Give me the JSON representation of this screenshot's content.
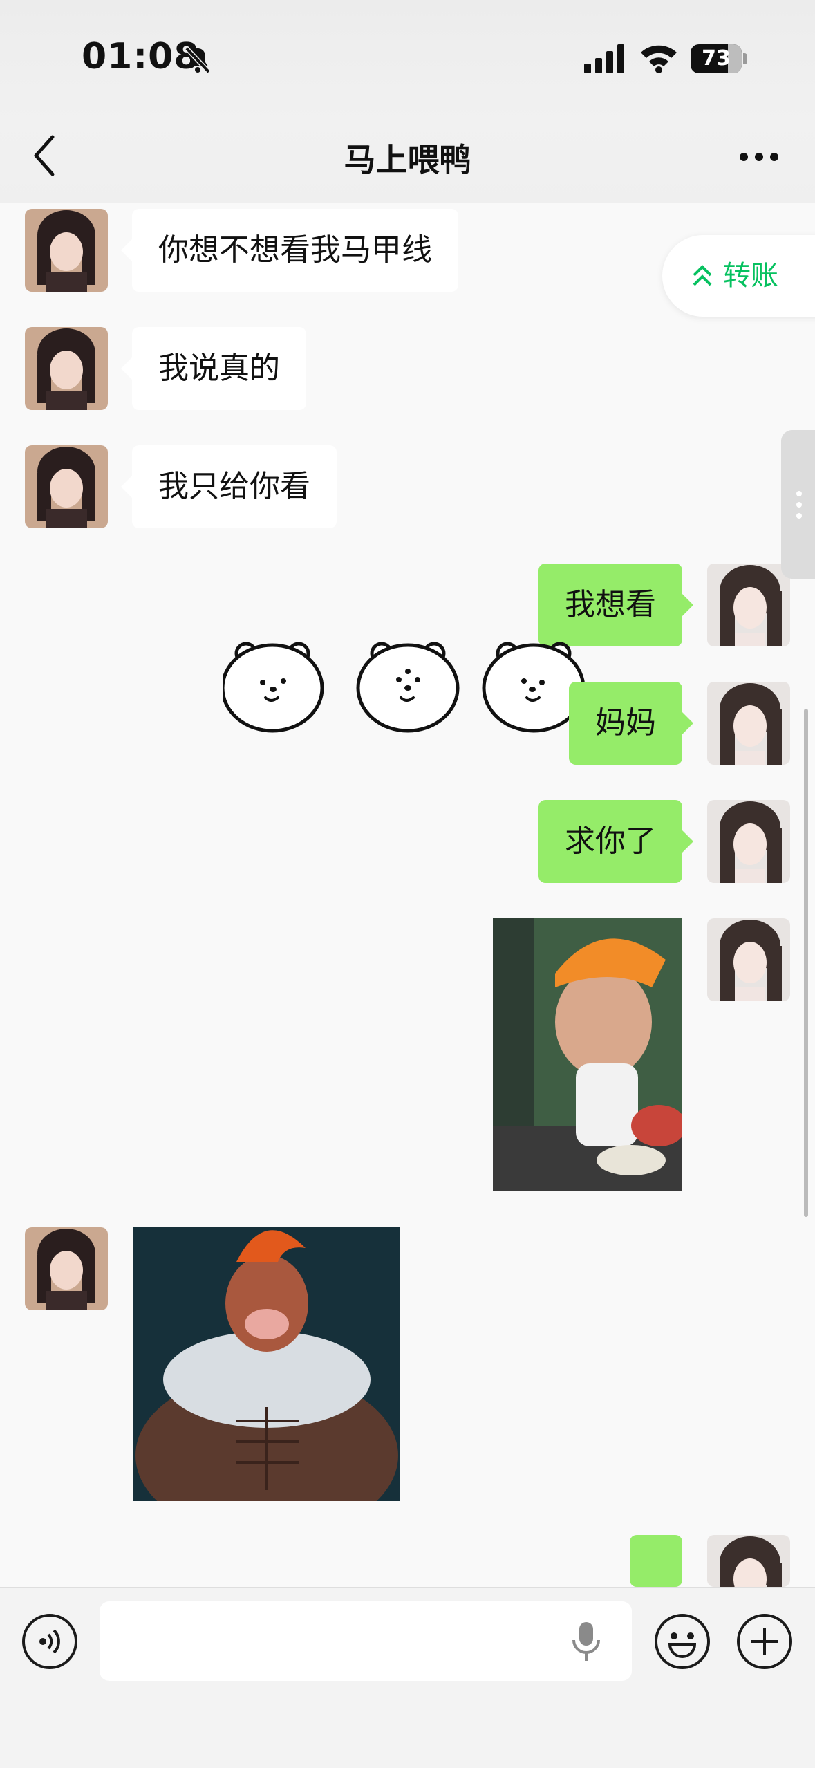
{
  "status_bar": {
    "time": "01:08",
    "battery": "73"
  },
  "nav": {
    "title": "马上喂鸭"
  },
  "transfer": {
    "label": "转账"
  },
  "messages": [
    {
      "side": "in",
      "type": "text",
      "text": "你想不想看我马甲线"
    },
    {
      "side": "in",
      "type": "text",
      "text": "我说真的"
    },
    {
      "side": "in",
      "type": "text",
      "text": "我只给你看"
    },
    {
      "side": "out",
      "type": "text",
      "text": "我想看"
    },
    {
      "side": "out",
      "type": "text",
      "text": "妈妈"
    },
    {
      "side": "out",
      "type": "text",
      "text": "求你了"
    },
    {
      "side": "out",
      "type": "image",
      "alt": "sticker-image"
    },
    {
      "side": "in",
      "type": "image",
      "alt": "sticker-image"
    },
    {
      "side": "out",
      "type": "text",
      "text": ""
    }
  ],
  "icons": {
    "mute": "bell-slash-icon",
    "signal": "signal-icon",
    "wifi": "wifi-icon",
    "back": "chevron-left-icon",
    "more": "ellipsis-icon",
    "voice": "voice-icon",
    "mic": "microphone-icon",
    "emoji": "emoji-icon",
    "plus": "plus-icon",
    "bear": "bear-sticker-icon"
  },
  "colors": {
    "outgoing_bubble": "#95ec69",
    "incoming_bubble": "#ffffff",
    "accent": "#07c160"
  }
}
